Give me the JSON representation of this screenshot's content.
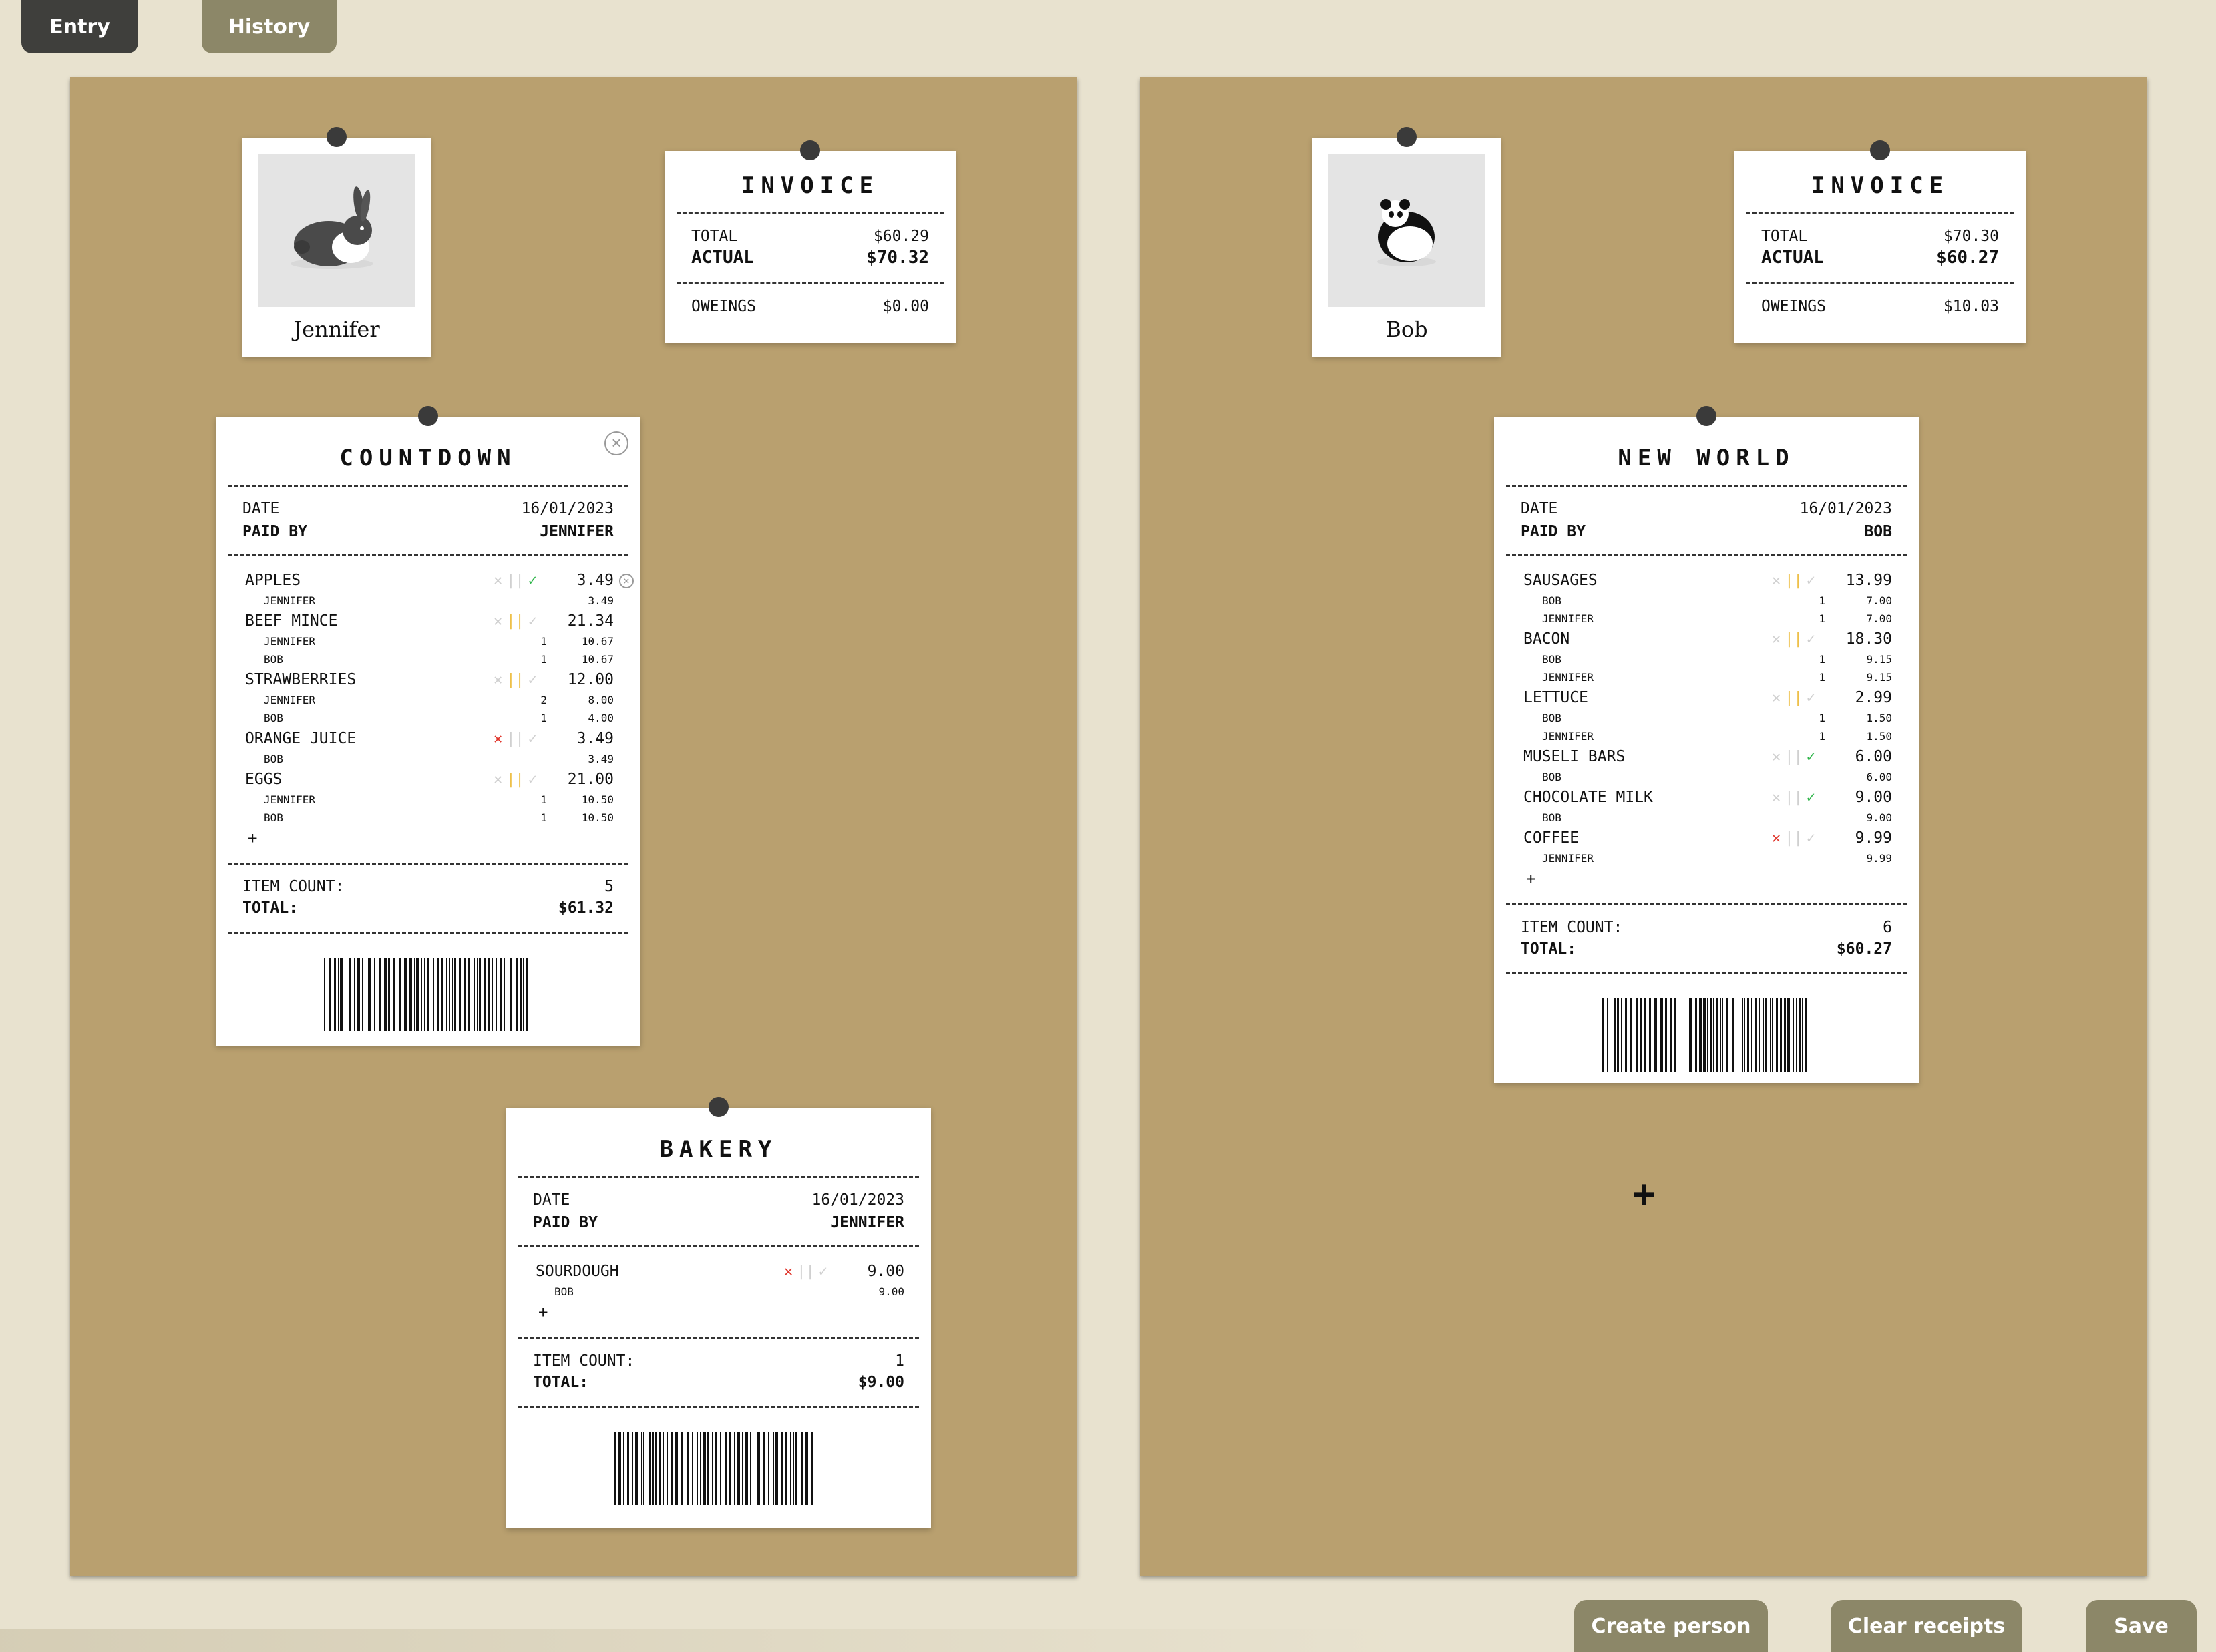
{
  "tabs": {
    "entry": "Entry",
    "history": "History"
  },
  "people": [
    {
      "name": "Jennifer",
      "invoice": {
        "title": "INVOICE",
        "total_label": "TOTAL",
        "total": "$60.29",
        "actual_label": "ACTUAL",
        "actual": "$70.32",
        "owe_label": "OWEINGS",
        "owe": "$0.00"
      },
      "receipts": [
        {
          "title": "COUNTDOWN",
          "date_label": "DATE",
          "date": "16/01/2023",
          "paid_label": "PAID BY",
          "paid": "JENNIFER",
          "items": [
            {
              "name": "APPLES",
              "price": "3.49",
              "x": false,
              "bar": false,
              "tick": true,
              "subs": [
                {
                  "n": "JENNIFER",
                  "q": "",
                  "p": "3.49"
                }
              ]
            },
            {
              "name": "BEEF MINCE",
              "price": "21.34",
              "x": false,
              "bar": true,
              "tick": false,
              "subs": [
                {
                  "n": "JENNIFER",
                  "q": "1",
                  "p": "10.67"
                },
                {
                  "n": "BOB",
                  "q": "1",
                  "p": "10.67"
                }
              ]
            },
            {
              "name": "STRAWBERRIES",
              "price": "12.00",
              "x": false,
              "bar": true,
              "tick": false,
              "subs": [
                {
                  "n": "JENNIFER",
                  "q": "2",
                  "p": "8.00"
                },
                {
                  "n": "BOB",
                  "q": "1",
                  "p": "4.00"
                }
              ]
            },
            {
              "name": "ORANGE JUICE",
              "price": "3.49",
              "x": true,
              "bar": false,
              "tick": false,
              "subs": [
                {
                  "n": "BOB",
                  "q": "",
                  "p": "3.49"
                }
              ]
            },
            {
              "name": "EGGS",
              "price": "21.00",
              "x": false,
              "bar": true,
              "tick": false,
              "subs": [
                {
                  "n": "JENNIFER",
                  "q": "1",
                  "p": "10.50"
                },
                {
                  "n": "BOB",
                  "q": "1",
                  "p": "10.50"
                }
              ]
            }
          ],
          "plus": "+",
          "count_label": "ITEM COUNT:",
          "count": "5",
          "total_label": "TOTAL:",
          "total": "$61.32"
        },
        {
          "title": "BAKERY",
          "date_label": "DATE",
          "date": "16/01/2023",
          "paid_label": "PAID BY",
          "paid": "JENNIFER",
          "items": [
            {
              "name": "SOURDOUGH",
              "price": "9.00",
              "x": true,
              "bar": false,
              "tick": false,
              "subs": [
                {
                  "n": "BOB",
                  "q": "",
                  "p": "9.00"
                }
              ]
            }
          ],
          "plus": "+",
          "count_label": "ITEM COUNT:",
          "count": "1",
          "total_label": "TOTAL:",
          "total": "$9.00"
        }
      ]
    },
    {
      "name": "Bob",
      "invoice": {
        "title": "INVOICE",
        "total_label": "TOTAL",
        "total": "$70.30",
        "actual_label": "ACTUAL",
        "actual": "$60.27",
        "owe_label": "OWEINGS",
        "owe": "$10.03"
      },
      "receipts": [
        {
          "title": "NEW WORLD",
          "date_label": "DATE",
          "date": "16/01/2023",
          "paid_label": "PAID BY",
          "paid": "BOB",
          "items": [
            {
              "name": "SAUSAGES",
              "price": "13.99",
              "x": false,
              "bar": true,
              "tick": false,
              "subs": [
                {
                  "n": "BOB",
                  "q": "1",
                  "p": "7.00"
                },
                {
                  "n": "JENNIFER",
                  "q": "1",
                  "p": "7.00"
                }
              ]
            },
            {
              "name": "BACON",
              "price": "18.30",
              "x": false,
              "bar": true,
              "tick": false,
              "subs": [
                {
                  "n": "BOB",
                  "q": "1",
                  "p": "9.15"
                },
                {
                  "n": "JENNIFER",
                  "q": "1",
                  "p": "9.15"
                }
              ]
            },
            {
              "name": "LETTUCE",
              "price": "2.99",
              "x": false,
              "bar": true,
              "tick": false,
              "subs": [
                {
                  "n": "BOB",
                  "q": "1",
                  "p": "1.50"
                },
                {
                  "n": "JENNIFER",
                  "q": "1",
                  "p": "1.50"
                }
              ]
            },
            {
              "name": "MUSELI BARS",
              "price": "6.00",
              "x": false,
              "bar": false,
              "tick": true,
              "subs": [
                {
                  "n": "BOB",
                  "q": "",
                  "p": "6.00"
                }
              ]
            },
            {
              "name": "CHOCOLATE MILK",
              "price": "9.00",
              "x": false,
              "bar": false,
              "tick": true,
              "subs": [
                {
                  "n": "BOB",
                  "q": "",
                  "p": "9.00"
                }
              ]
            },
            {
              "name": "COFFEE",
              "price": "9.99",
              "x": true,
              "bar": false,
              "tick": false,
              "subs": [
                {
                  "n": "JENNIFER",
                  "q": "",
                  "p": "9.99"
                }
              ]
            }
          ],
          "plus": "+",
          "count_label": "ITEM COUNT:",
          "count": "6",
          "total_label": "TOTAL:",
          "total": "$60.27"
        }
      ]
    }
  ],
  "board_plus": "+",
  "buttons": {
    "create": "Create person",
    "clear": "Clear receipts",
    "save": "Save"
  },
  "icons": {
    "x": "✕",
    "bar": "||",
    "tick": "✓",
    "close": "×"
  }
}
